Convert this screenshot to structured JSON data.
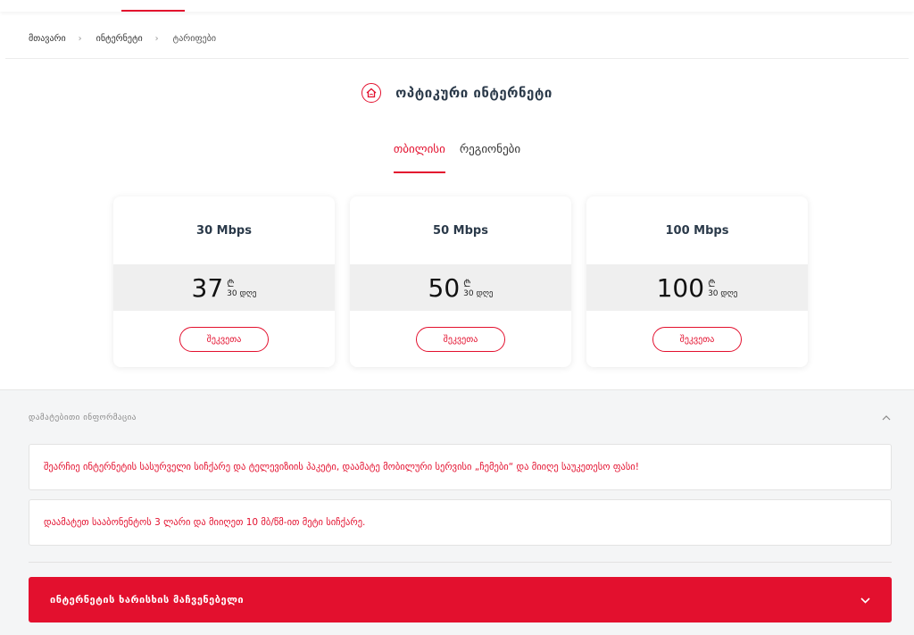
{
  "breadcrumb": {
    "items": [
      "მთავარი",
      "ინტერნეტი",
      "ტარიფები"
    ]
  },
  "section": {
    "title": "ოპტიკური ინტერნეტი",
    "icon": "house-wifi-icon"
  },
  "tabs": [
    {
      "label": "თბილისი",
      "active": true
    },
    {
      "label": "რეგიონები",
      "active": false
    }
  ],
  "plans": [
    {
      "speed": "30 Mbps",
      "price": "37",
      "currency": "₾",
      "period": "30 დღე",
      "button": "შეკვეთა"
    },
    {
      "speed": "50 Mbps",
      "price": "50",
      "currency": "₾",
      "period": "30 დღე",
      "button": "შეკვეთა"
    },
    {
      "speed": "100 Mbps",
      "price": "100",
      "currency": "₾",
      "period": "30 დღე",
      "button": "შეკვეთა"
    }
  ],
  "info": {
    "header": "დამატებითი ინფორმაცია",
    "items": [
      "შეარჩიე ინტერნეტის სასურველი სიჩქარე და ტელევიზიის პაკეტი, დაამატე მობილური სერვისი „ჩემები“ და მიიღე საუკეთესო ფასი!",
      "დაამატეთ სააბონენტოს 3 ლარი და მიიღეთ 10 მბ/წმ-ით მეტი სიჩქარე."
    ]
  },
  "quality": {
    "label": "ინტერნეტის ხარისხის მაჩვენებელი"
  },
  "colors": {
    "accent": "#e3102e",
    "title": "#2b3a4a",
    "band": "#efefef",
    "info_bg": "#f4f5f6"
  }
}
